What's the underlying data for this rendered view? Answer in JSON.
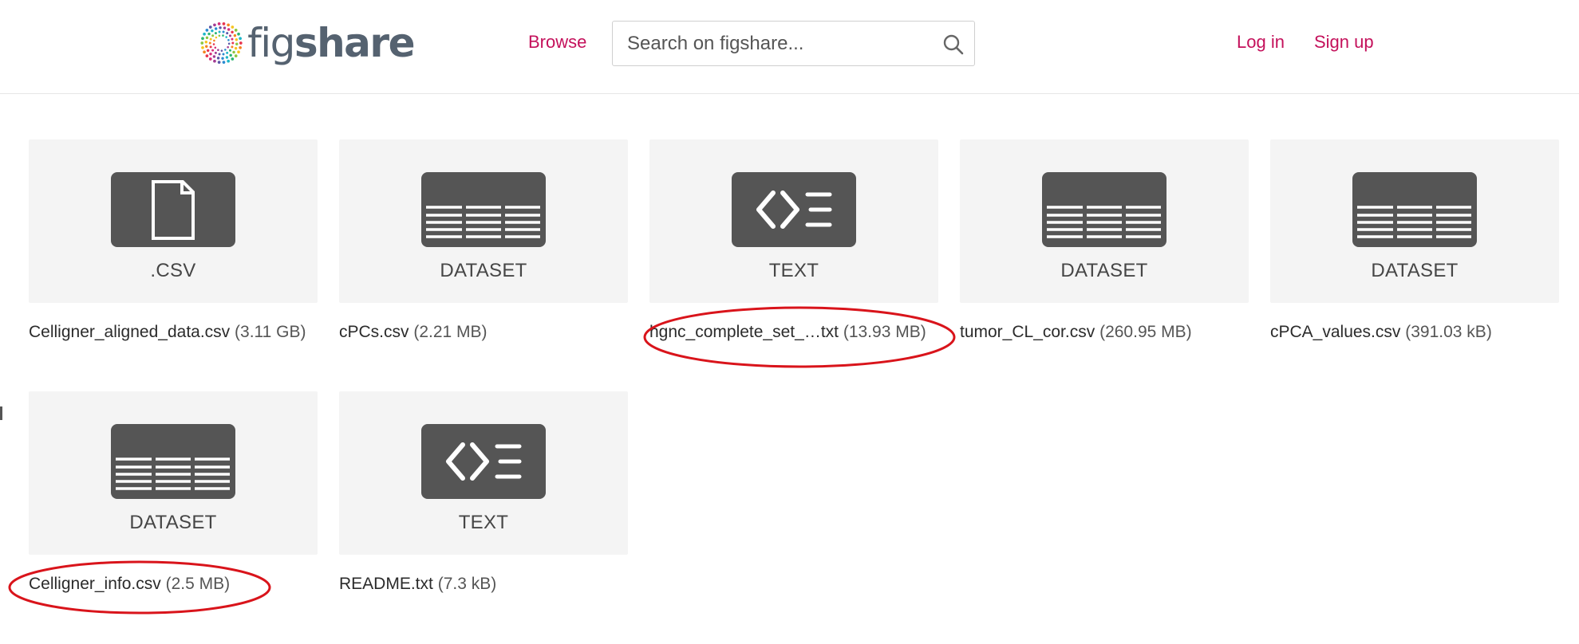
{
  "header": {
    "logo_icon": "figshare-dots-logo-icon",
    "logo_text_prefix": "fig",
    "logo_text_suffix": "share",
    "browse_label": "Browse",
    "search_placeholder": "Search on figshare...",
    "search_value": "",
    "search_icon": "search-icon",
    "login_label": "Log in",
    "signup_label": "Sign up"
  },
  "colors": {
    "brand_link": "#c4115b",
    "tile_bg": "#f4f4f4",
    "icon_bg": "#555555",
    "annotation": "#d9141b"
  },
  "files": [
    {
      "type_label": ".CSV",
      "icon": "file-icon",
      "name": "Celligner_aligned_data.csv",
      "size": "(3.11 GB)"
    },
    {
      "type_label": "DATASET",
      "icon": "table-icon",
      "name": "cPCs.csv",
      "size": "(2.21 MB)"
    },
    {
      "type_label": "TEXT",
      "icon": "code-text-icon",
      "name_start": "hgnc_complete_set_",
      "name_end": "txt",
      "size": "(13.93 MB)"
    },
    {
      "type_label": "DATASET",
      "icon": "table-icon",
      "name": "tumor_CL_cor.csv",
      "size": "(260.95 MB)"
    },
    {
      "type_label": "DATASET",
      "icon": "table-icon",
      "name": "cPCA_values.csv",
      "size": "(391.03 kB)"
    },
    {
      "type_label": "DATASET",
      "icon": "table-icon",
      "name": "Celligner_info.csv",
      "size": "(2.5 MB)"
    },
    {
      "type_label": "TEXT",
      "icon": "code-text-icon",
      "name": "README.txt",
      "size": "(7.3 kB)"
    }
  ]
}
